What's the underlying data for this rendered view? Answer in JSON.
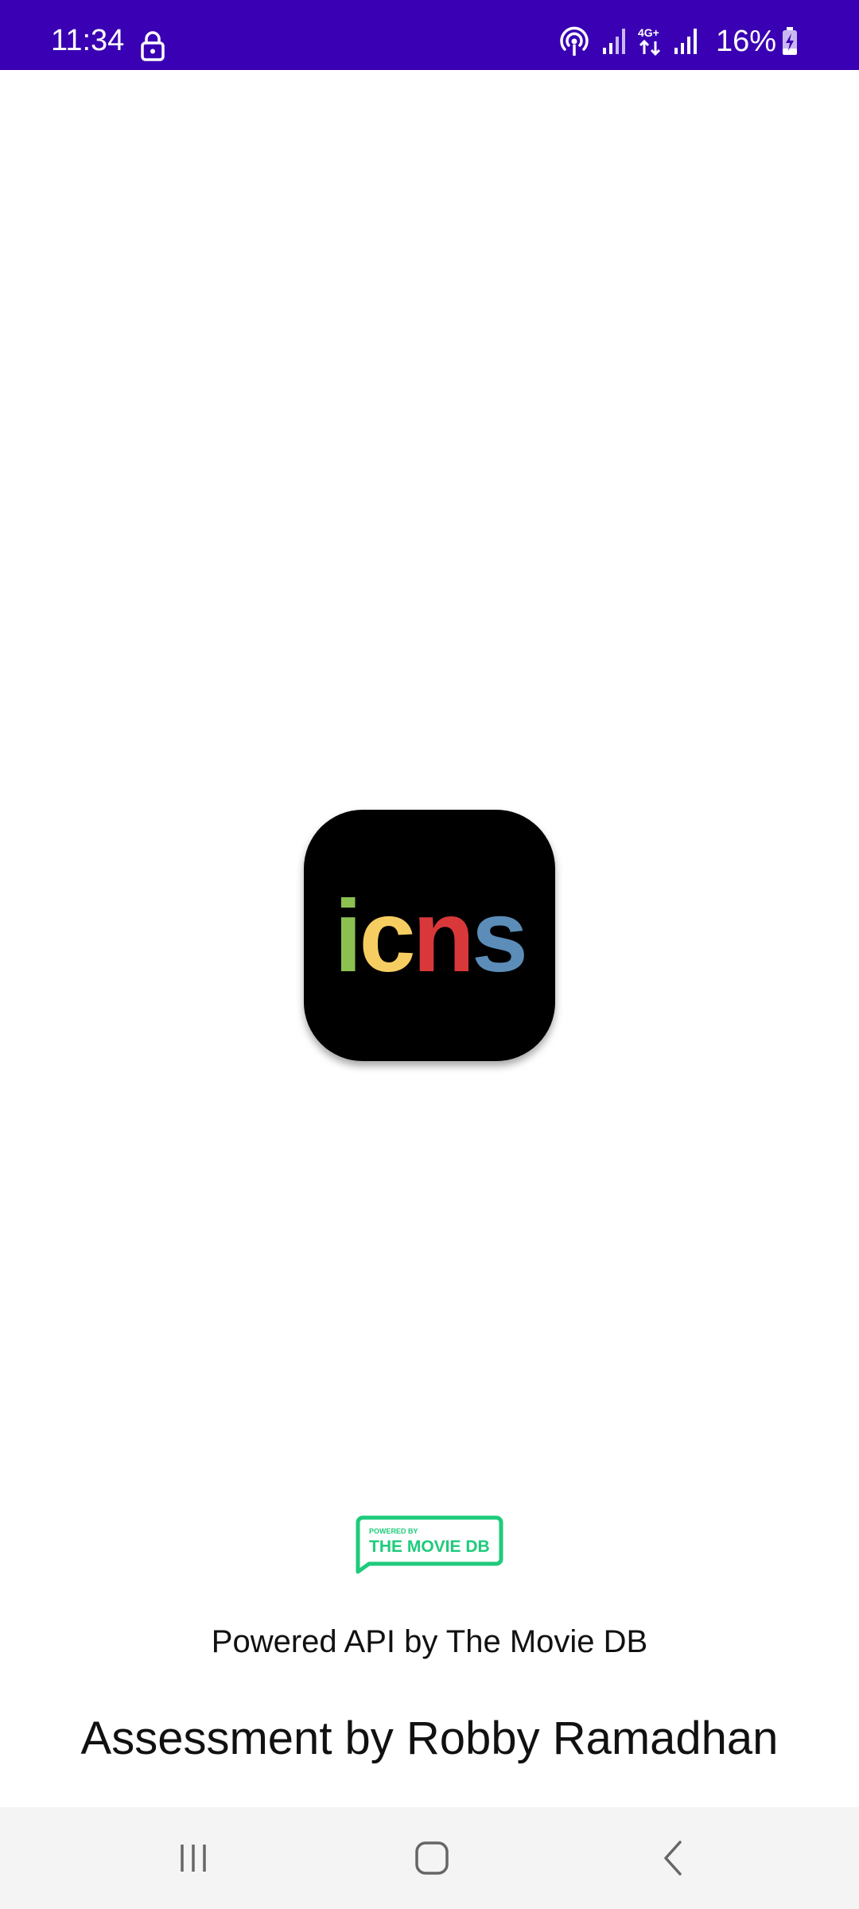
{
  "status_bar": {
    "time": "11:34",
    "battery_percent": "16%",
    "network_type": "4G+",
    "background_color": "#3a00b3",
    "icons": [
      "lock-icon",
      "hotspot-icon",
      "signal-icon",
      "network-4g-icon",
      "signal-icon",
      "battery-charging-icon"
    ]
  },
  "app_logo": {
    "letters": [
      {
        "char": "i",
        "color": "#8cc152"
      },
      {
        "char": "c",
        "color": "#f6cd61"
      },
      {
        "char": "n",
        "color": "#d9383a"
      },
      {
        "char": "s",
        "color": "#5b8db8"
      }
    ],
    "background_color": "#000000"
  },
  "tmdb_badge": {
    "small_text": "POWERED BY",
    "large_text": "THE MOVIE DB",
    "color": "#1ecb7b"
  },
  "footer": {
    "powered_text": "Powered API by The Movie DB",
    "assessment_text": "Assessment by Robby Ramadhan"
  },
  "nav_bar": {
    "buttons": [
      "recents-icon",
      "home-icon",
      "back-icon"
    ]
  }
}
